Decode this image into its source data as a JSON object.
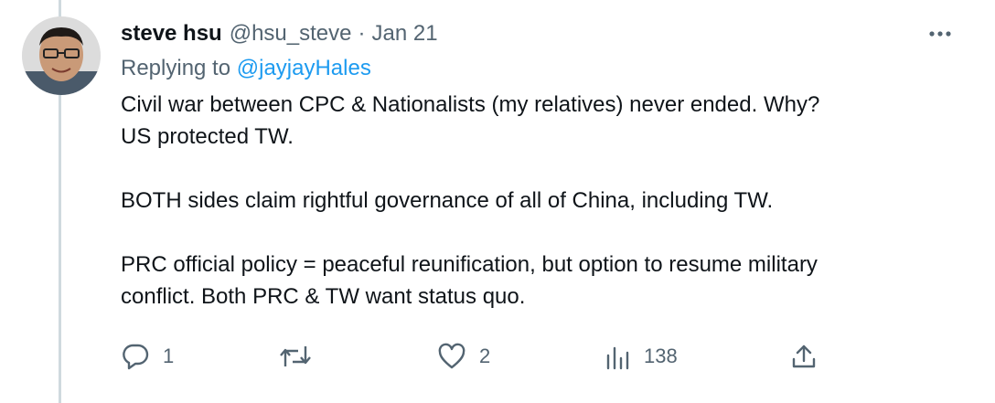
{
  "tweet": {
    "author_name": "steve hsu",
    "handle": "@hsu_steve",
    "separator": "·",
    "date": "Jan 21",
    "replying_prefix": "Replying to",
    "replying_to": "@jayjayHales",
    "body": {
      "para1_line1": "Civil war between CPC & Nationalists (my relatives) never ended. Why?",
      "para1_line2": "US protected TW.",
      "para2_line1": "BOTH sides claim rightful governance of all of China, including TW.",
      "para3_line1": "PRC official policy = peaceful reunification, but option to resume military",
      "para3_line2": "conflict. Both PRC & TW want status quo."
    },
    "actions": {
      "reply_count": "1",
      "retweet_count": "",
      "like_count": "2",
      "views_count": "138"
    },
    "icons": {
      "more": "more-options-icon",
      "reply": "reply-icon",
      "retweet": "retweet-icon",
      "like": "heart-icon",
      "views": "views-chart-icon",
      "share": "share-icon"
    },
    "colors": {
      "text": "#0f1419",
      "secondary": "#536471",
      "link": "#1d9bf0",
      "thread_line": "#cfd9de"
    }
  }
}
